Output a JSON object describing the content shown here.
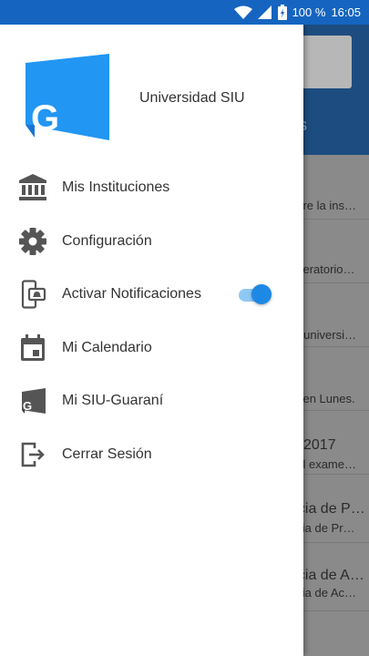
{
  "status_bar": {
    "battery_text": "100 %",
    "time": "16:05",
    "icons": [
      "wifi-icon",
      "signal-icon",
      "battery-icon"
    ]
  },
  "drawer": {
    "brand_name": "Universidad SIU",
    "logo_letter": "G",
    "items": [
      {
        "label": "Mis Instituciones",
        "icon": "institution-icon"
      },
      {
        "label": "Configuración",
        "icon": "gear-icon"
      },
      {
        "label": "Activar Notificaciones",
        "icon": "phone-notification-icon",
        "toggle_on": true
      },
      {
        "label": "Mi Calendario",
        "icon": "calendar-icon"
      },
      {
        "label": "Mi SIU-Guaraní",
        "icon": "guarani-icon"
      },
      {
        "label": "Cerrar Sesión",
        "icon": "logout-icon"
      }
    ]
  },
  "background": {
    "tab_fragment": "os",
    "rows": [
      {
        "line1": "abre la ins…"
      },
      {
        "line1": "uperatorio…"
      },
      {
        "line1": "or universi…"
      },
      {
        "line1": "puen Lunes."
      },
      {
        "line1": "2017",
        "line2": "del exame…"
      },
      {
        "line1": "ncia de P…",
        "line2": "ncia de Pr…"
      },
      {
        "line1": "ncia de A…",
        "line2": "ncia de Ac…"
      }
    ]
  },
  "colors": {
    "status_bar": "#1565c0",
    "accent": "#1e88e5",
    "logo_blue": "#2196f3"
  }
}
